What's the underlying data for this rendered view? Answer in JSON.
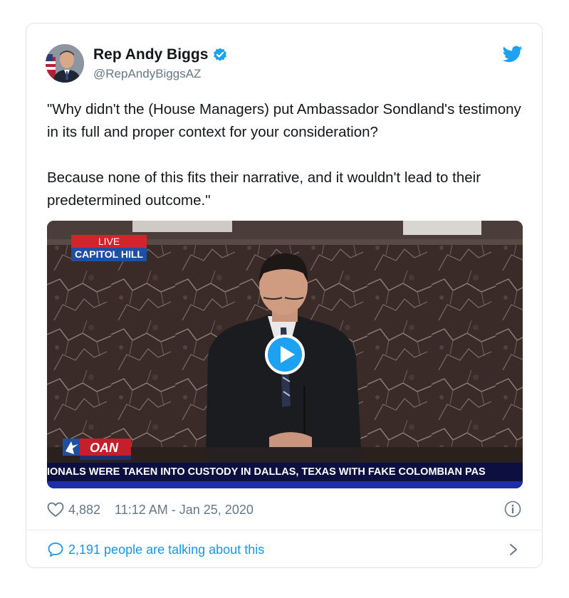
{
  "tweet": {
    "author_name": "Rep Andy Biggs",
    "author_handle": "@RepAndyBiggsAZ",
    "verified": true,
    "paragraphs": [
      "\"Why didn't the (House Managers) put Ambassador Sondland's testimony in its full and proper context for your consideration?",
      "Because none of this fits their narrative, and it wouldn't lead to their predetermined outcome.\""
    ],
    "likes": "4,882",
    "timestamp": "11:12 AM - Jan 25, 2020",
    "talking_text": "2,191 people are talking about this"
  },
  "video": {
    "live_label": "LIVE",
    "location_label": "CAPITOL HILL",
    "channel_logo": "OAN",
    "ticker_text": "IONALS WERE TAKEN INTO CUSTODY IN DALLAS, TEXAS WITH FAKE COLOMBIAN PAS"
  },
  "icons": {
    "verified": "verified-badge-icon",
    "brand": "twitter-bird-icon",
    "like": "heart-icon",
    "info": "info-icon",
    "reply": "speech-bubble-icon",
    "more": "chevron-right-icon",
    "play": "play-icon"
  },
  "colors": {
    "brand_blue": "#1da1f2",
    "link_blue": "#1b95e0",
    "secondary_text": "#657786",
    "live_red": "#d3232b",
    "location_blue": "#1f4ea3"
  }
}
